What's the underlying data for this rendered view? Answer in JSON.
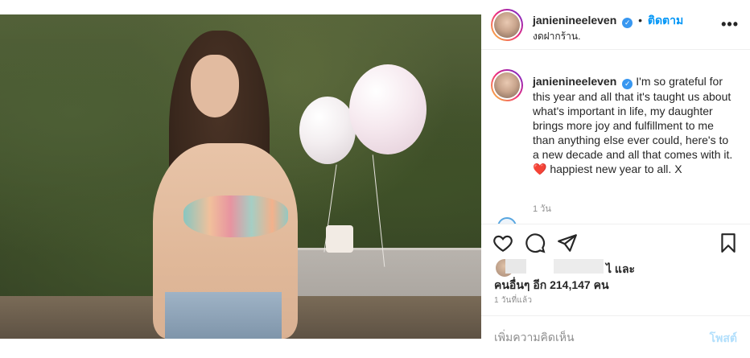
{
  "post": {
    "username": "janienineeleven",
    "verified_icon": "verified-badge-icon",
    "separator": "•",
    "follow_label": "ติดตาม",
    "location": "งดฝากร้าน.",
    "more_icon": "more-options-icon",
    "more_label": "•••"
  },
  "caption": {
    "username": "janienineeleven",
    "text": "I'm so grateful for this year and all that it's taught us about what's important in life, my daughter brings more joy and fulfillment to me than anything else ever could, here's to a new decade and all that comes with it. ",
    "emoji": "❤️",
    "text_tail": " happiest new year to all. X",
    "time_ago": "1 วัน"
  },
  "actions": {
    "like_icon": "heart-icon",
    "comment_icon": "comment-icon",
    "share_icon": "send-icon",
    "save_icon": "bookmark-icon"
  },
  "likes": {
    "line1_suffix": "ไ และ",
    "line2": "คนอื่นๆ อีก 214,147 คน"
  },
  "posted_ago": "1 วันที่แล้ว",
  "comment_box": {
    "placeholder": "เพิ่มความคิดเห็น",
    "post_label": "โพสต์"
  },
  "colors": {
    "accent": "#0095f6",
    "post_disabled": "#b2dffc",
    "verified": "#3897f0"
  }
}
